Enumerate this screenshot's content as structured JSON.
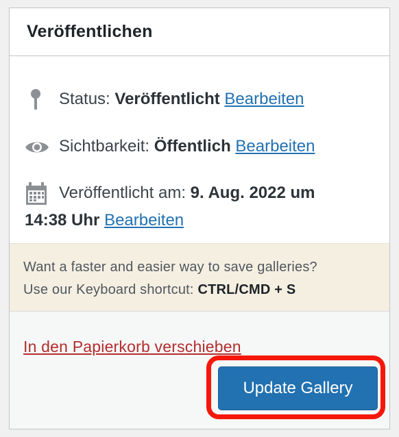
{
  "box": {
    "title": "Veröffentlichen"
  },
  "status": {
    "label": "Status:",
    "value": "Veröffentlicht",
    "edit": "Bearbeiten",
    "icon": "pin-icon"
  },
  "visibility": {
    "label": "Sichtbarkeit:",
    "value": "Öffentlich",
    "edit": "Bearbeiten",
    "icon": "eye-icon"
  },
  "published": {
    "label": "Veröffentlicht am:",
    "value": "9. Aug. 2022 um 14:38 Uhr",
    "edit": "Bearbeiten",
    "icon": "calendar-icon"
  },
  "notice": {
    "line1": "Want a faster and easier way to save galleries?",
    "line2_prefix": "Use our Keyboard shortcut:",
    "shortcut": "CTRL/CMD + S"
  },
  "actions": {
    "trash": "In den Papierkorb verschieben",
    "update": "Update Gallery"
  },
  "colors": {
    "accent": "#2271b1",
    "danger": "#b32d2e",
    "highlight": "#f5180a"
  }
}
